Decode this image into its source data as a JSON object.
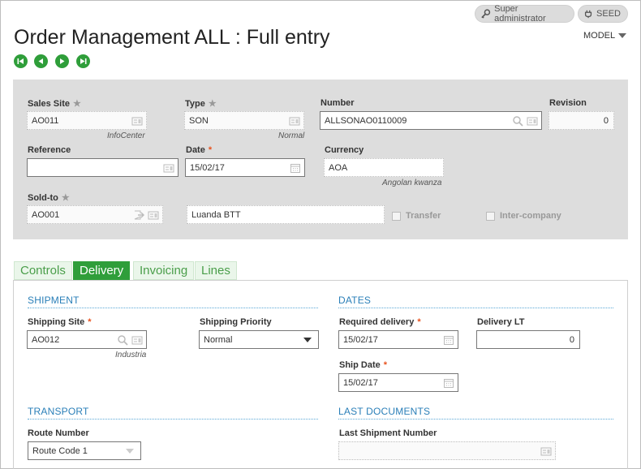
{
  "topbar": {
    "user_label": "Super administrator",
    "folder_label": "SEED"
  },
  "page": {
    "title": "Order Management ALL : Full entry",
    "model_label": "MODEL"
  },
  "header": {
    "sales_site": {
      "label": "Sales Site",
      "value": "AO011",
      "sub": "InfoCenter"
    },
    "type": {
      "label": "Type",
      "value": "SON",
      "sub": "Normal"
    },
    "number": {
      "label": "Number",
      "value": "ALLSONAO0110009"
    },
    "revision": {
      "label": "Revision",
      "value": "0"
    },
    "reference": {
      "label": "Reference",
      "value": ""
    },
    "date": {
      "label": "Date",
      "value": "15/02/17"
    },
    "currency": {
      "label": "Currency",
      "value": "AOA",
      "sub": "Angolan kwanza"
    },
    "sold_to": {
      "label": "Sold-to",
      "value": "AO001",
      "name": "Luanda BTT"
    },
    "transfer_label": "Transfer",
    "intercompany_label": "Inter-company"
  },
  "tabs": [
    {
      "label": "Controls",
      "active": false
    },
    {
      "label": "Delivery",
      "active": true
    },
    {
      "label": "Invoicing",
      "active": false
    },
    {
      "label": "Lines",
      "active": false
    }
  ],
  "delivery": {
    "shipment_title": "SHIPMENT",
    "dates_title": "DATES",
    "shipping_site": {
      "label": "Shipping Site",
      "value": "AO012",
      "sub": "Industria"
    },
    "shipping_priority": {
      "label": "Shipping Priority",
      "value": "Normal"
    },
    "required_delivery": {
      "label": "Required delivery",
      "value": "15/02/17"
    },
    "delivery_lt": {
      "label": "Delivery LT",
      "value": "0"
    },
    "ship_date": {
      "label": "Ship Date",
      "value": "15/02/17"
    },
    "transport_title": "TRANSPORT",
    "last_documents_title": "LAST DOCUMENTS",
    "route_number": {
      "label": "Route Number",
      "value": "Route Code 1"
    },
    "last_shipment": {
      "label": "Last Shipment Number",
      "value": ""
    }
  },
  "colors": {
    "accent_green": "#2f9e3a",
    "section_blue": "#2a7fb8",
    "required_orange": "#e8521e"
  }
}
